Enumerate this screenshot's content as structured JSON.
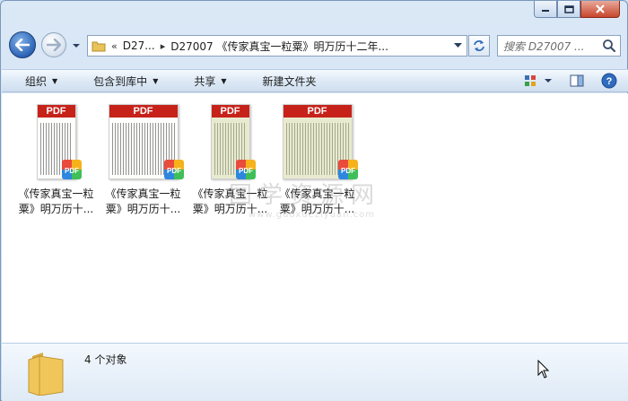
{
  "window": {
    "caption": {
      "minimize_icon": "minimize-icon",
      "maximize_icon": "maximize-icon",
      "close_icon": "close-icon"
    }
  },
  "address_bar": {
    "overflow": "«",
    "crumbs": [
      "D27...",
      "D27007 《传家真宝一粒粟》明万历十二年..."
    ],
    "search_placeholder": "搜索 D27007 ..."
  },
  "toolbar": {
    "organize": "组织",
    "include_in_library": "包含到库中",
    "share": "共享",
    "new_folder": "新建文件夹"
  },
  "files": [
    {
      "line1": "《传家真宝一粒",
      "line2": "粟》明万历十...",
      "type": "PDF",
      "aged": false,
      "wide": false
    },
    {
      "line1": "《传家真宝一粒",
      "line2": "粟》明万历十...",
      "type": "PDF",
      "aged": false,
      "wide": true
    },
    {
      "line1": "《传家真宝一粒",
      "line2": "粟》明万历十...",
      "type": "PDF",
      "aged": true,
      "wide": false
    },
    {
      "line1": "《传家真宝一粒",
      "line2": "粟》明万历十...",
      "type": "PDF",
      "aged": true,
      "wide": true
    }
  ],
  "watermark": {
    "title": "国学资源网",
    "url": "www.guoxueziyuan.com"
  },
  "details": {
    "count": "4 个对象"
  },
  "colors": {
    "pdf_red": "#c7221a",
    "frame_blue": "#cfe0f2"
  }
}
